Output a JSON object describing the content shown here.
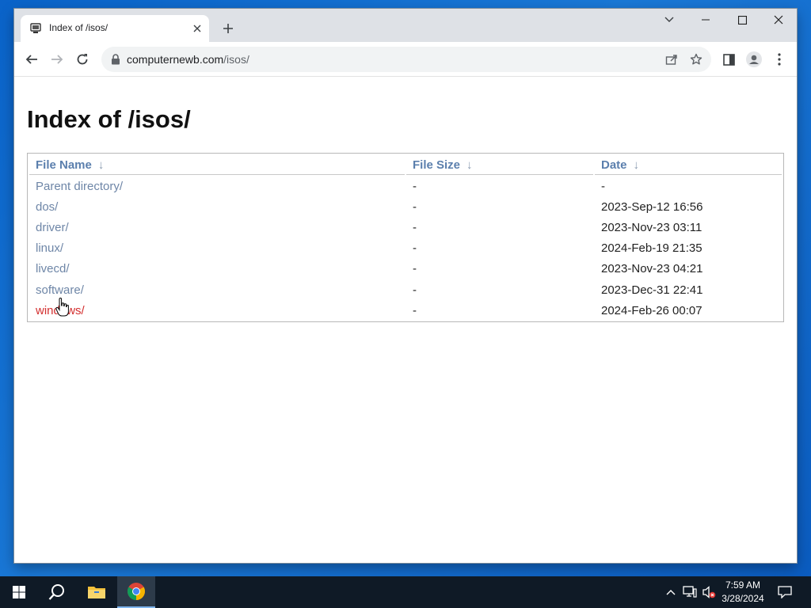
{
  "browser": {
    "tab_title": "Index of /isos/",
    "url_domain": "computernewb.com",
    "url_path": "/isos/"
  },
  "page": {
    "heading": "Index of /isos/",
    "columns": {
      "name": "File Name",
      "size": "File Size",
      "date": "Date",
      "sort_arrow": "↓"
    },
    "rows": [
      {
        "name": "Parent directory/",
        "size": "-",
        "date": "-"
      },
      {
        "name": "dos/",
        "size": "-",
        "date": "2023-Sep-12 16:56"
      },
      {
        "name": "driver/",
        "size": "-",
        "date": "2023-Nov-23 03:11"
      },
      {
        "name": "linux/",
        "size": "-",
        "date": "2024-Feb-19 21:35"
      },
      {
        "name": "livecd/",
        "size": "-",
        "date": "2023-Nov-23 04:21"
      },
      {
        "name": "software/",
        "size": "-",
        "date": "2023-Dec-31 22:41"
      },
      {
        "name": "windows/",
        "size": "-",
        "date": "2024-Feb-26 00:07"
      }
    ]
  },
  "taskbar": {
    "time": "7:59 AM",
    "date": "3/28/2024"
  },
  "colors": {
    "link": "#6e86a7",
    "link_hover": "#d32f2f",
    "header_link": "#5b7fad",
    "taskbar": "#0f1a26"
  }
}
